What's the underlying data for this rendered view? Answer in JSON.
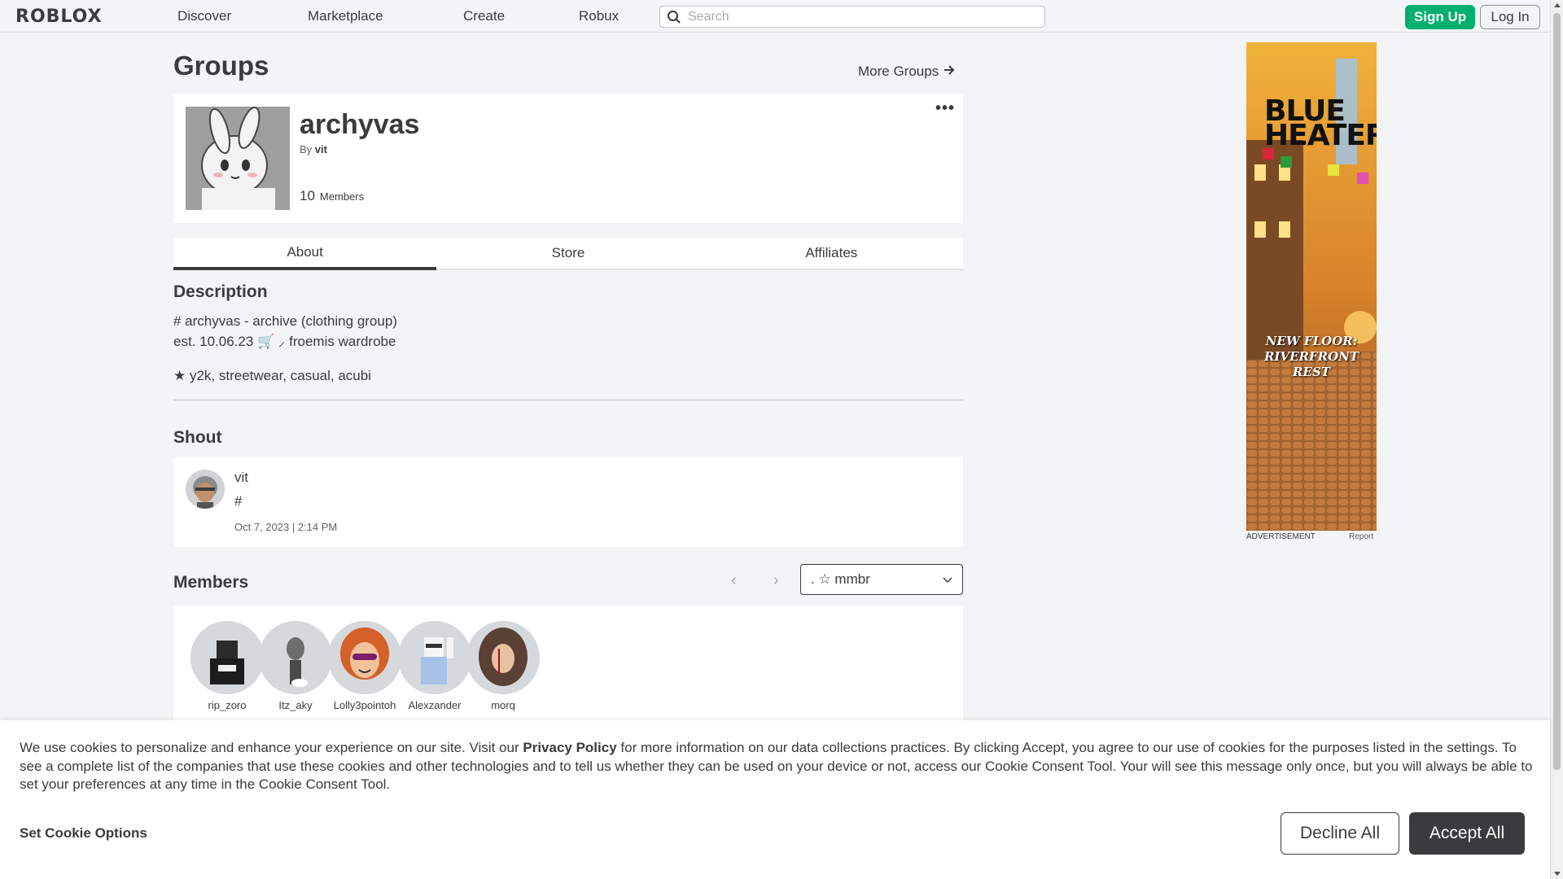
{
  "nav": {
    "logo": "ROBLOX",
    "links": [
      "Discover",
      "Marketplace",
      "Create",
      "Robux"
    ],
    "search_placeholder": "Search",
    "signup": "Sign Up",
    "login": "Log In"
  },
  "page": {
    "title": "Groups",
    "more_groups": "More Groups"
  },
  "group": {
    "name": "archyvas",
    "by_prefix": "By",
    "owner": "vit",
    "member_count": "10",
    "member_label": "Members",
    "menu": "•••"
  },
  "tabs": [
    "About",
    "Store",
    "Affiliates"
  ],
  "about": {
    "description_heading": "Description",
    "description_lines": [
      "# archyvas - archive (clothing group)",
      "est. 10.06.23 🛒  ⸝ froemis wardrobe",
      "★ y2k, streetwear, casual, acubi"
    ]
  },
  "shout": {
    "heading": "Shout",
    "user": "vit",
    "body": "#",
    "date": "Oct 7, 2023 | 2:14 PM"
  },
  "members": {
    "heading": "Members",
    "role_selected": ". ☆ mmbr",
    "list": [
      {
        "name": "rip_zoro",
        "color": "#2b2b2b"
      },
      {
        "name": "Itz_aky",
        "color": "#6d6d6d"
      },
      {
        "name": "Lolly3pointoh",
        "color": "#d4602a"
      },
      {
        "name": "Alexzander",
        "color": "#a7c1e8"
      },
      {
        "name": "morq",
        "color": "#5a4035"
      }
    ]
  },
  "ad": {
    "title_line1": "BLUE",
    "title_line2": "HEATER",
    "subtitle_line1": "NEW FLOOR:",
    "subtitle_line2": "RIVERFRONT REST",
    "label": "ADVERTISEMENT",
    "report": "Report"
  },
  "cookie": {
    "text_before": "We use cookies to personalize and enhance your experience on our site. Visit our ",
    "privacy_link": "Privacy Policy",
    "text_after": " for more information on our data collections practices. By clicking Accept, you agree to our use of cookies for the purposes listed in the settings. To see a complete list of the companies that use these cookies and other technologies and to tell us whether they can be used on your device or not, access our Cookie Consent Tool. Your will see this message only once, but you will always be able to set your preferences at any time in the Cookie Consent Tool.",
    "options": "Set Cookie Options",
    "decline": "Decline All",
    "accept": "Accept All"
  },
  "colors": {
    "signup_green": "#00b06f",
    "dark_button": "#393b3d",
    "page_bg": "#f2f4f5"
  }
}
